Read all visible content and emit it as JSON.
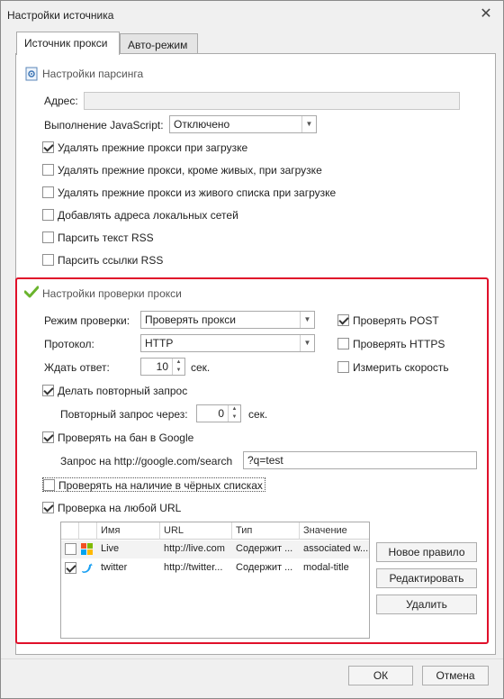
{
  "window": {
    "title": "Настройки источника"
  },
  "tabs": [
    {
      "label": "Источник прокси",
      "active": true
    },
    {
      "label": "Авто-режим",
      "active": false
    }
  ],
  "parsing": {
    "title": "Настройки парсинга",
    "address_label": "Адрес:",
    "address_value": "",
    "js_label": "Выполнение JavaScript:",
    "js_value": "Отключено",
    "checkboxes": [
      {
        "label": "Удалять прежние прокси при загрузке",
        "checked": true
      },
      {
        "label": "Удалять прежние прокси, кроме живых, при загрузке",
        "checked": false
      },
      {
        "label": "Удалять прежние прокси из живого списка при загрузке",
        "checked": false
      },
      {
        "label": "Добавлять адреса локальных сетей",
        "checked": false
      },
      {
        "label": "Парсить текст RSS",
        "checked": false
      },
      {
        "label": "Парсить ссылки RSS",
        "checked": false
      }
    ]
  },
  "check": {
    "title": "Настройки проверки прокси",
    "mode_label": "Режим проверки:",
    "mode_value": "Проверять прокси",
    "protocol_label": "Протокол:",
    "protocol_value": "HTTP",
    "wait_label": "Ждать ответ:",
    "wait_value": "10",
    "wait_unit": "сек.",
    "post": {
      "label": "Проверять POST",
      "checked": true
    },
    "https": {
      "label": "Проверять HTTPS",
      "checked": false
    },
    "speed": {
      "label": "Измерить скорость",
      "checked": false
    },
    "retry": {
      "label": "Делать повторный запрос",
      "checked": true
    },
    "retry_after_label": "Повторный запрос через:",
    "retry_after_value": "0",
    "retry_after_unit": "сек.",
    "google_ban": {
      "label": "Проверять на бан в Google",
      "checked": true
    },
    "google_query_label": "Запрос на http://google.com/search",
    "google_query_value": "?q=test",
    "blacklist": {
      "label": "Проверять на наличие в чёрных списках",
      "checked": false
    },
    "any_url": {
      "label": "Проверка на любой URL",
      "checked": true
    }
  },
  "grid": {
    "columns": [
      "Имя",
      "URL",
      "Тип",
      "Значение"
    ],
    "rows": [
      {
        "checked": false,
        "icon": "windows-icon",
        "name": "Live",
        "url": "http://live.com",
        "type": "Содержит ...",
        "value": "associated w..."
      },
      {
        "checked": true,
        "icon": "twitter-icon",
        "name": "twitter",
        "url": "http://twitter...",
        "type": "Содержит ...",
        "value": "modal-title"
      }
    ]
  },
  "buttons": {
    "new_rule": "Новое правило",
    "edit": "Редактировать",
    "delete": "Удалить",
    "ok": "ОК",
    "cancel": "Отмена"
  },
  "colors": {
    "highlight_border": "#e0102a",
    "check_accent": "#6ab42d",
    "twitter": "#1da1f2"
  }
}
